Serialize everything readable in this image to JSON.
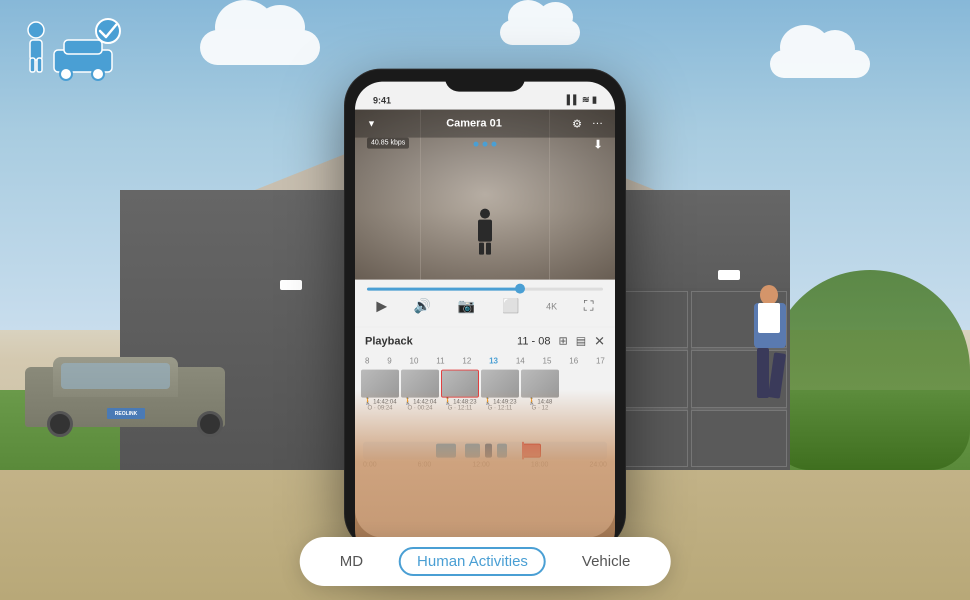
{
  "background": {
    "sky_color": "#87b8d8",
    "ground_color": "#c8b890"
  },
  "corner_badge": {
    "alt": "Person and car with checkmark icon"
  },
  "phone": {
    "status_bar": {
      "time": "9:41",
      "signal": "▌▌▌",
      "wifi": "WiFi",
      "battery": "🔋"
    },
    "camera": {
      "title": "Camera 01",
      "speed": "40.85 kbps",
      "dropdown_icon": "▼"
    },
    "controls": {
      "play_label": "▶",
      "volume_label": "🔊",
      "snapshot_label": "📷",
      "record_label": "⬜",
      "quality_label": "4K",
      "fullscreen_label": "⛶"
    },
    "playback": {
      "title": "Playback",
      "date": "11 - 08"
    },
    "timeline": {
      "numbers": [
        "8",
        "9",
        "10",
        "11",
        "12",
        "13",
        "14",
        "15",
        "16",
        "17"
      ],
      "active_num": "13"
    },
    "thumbnails": [
      {
        "time": "14:42:04",
        "sub": "O · 09:24"
      },
      {
        "time": "14:42:04",
        "sub": "O · 00:24"
      },
      {
        "time": "14:48:23",
        "sub": "G · 12:11"
      },
      {
        "time": "14:49:23",
        "sub": "G · 12:11"
      },
      {
        "time": "14:48",
        "sub": "G · 12"
      }
    ],
    "scrubber": {
      "times": [
        "0:00",
        "6:00",
        "12:00",
        "18:00",
        "24:00"
      ]
    }
  },
  "filter_tabs": {
    "items": [
      {
        "label": "MD",
        "active": false
      },
      {
        "label": "Human Activities",
        "active": true
      },
      {
        "label": "Vehicle",
        "active": false
      }
    ]
  }
}
